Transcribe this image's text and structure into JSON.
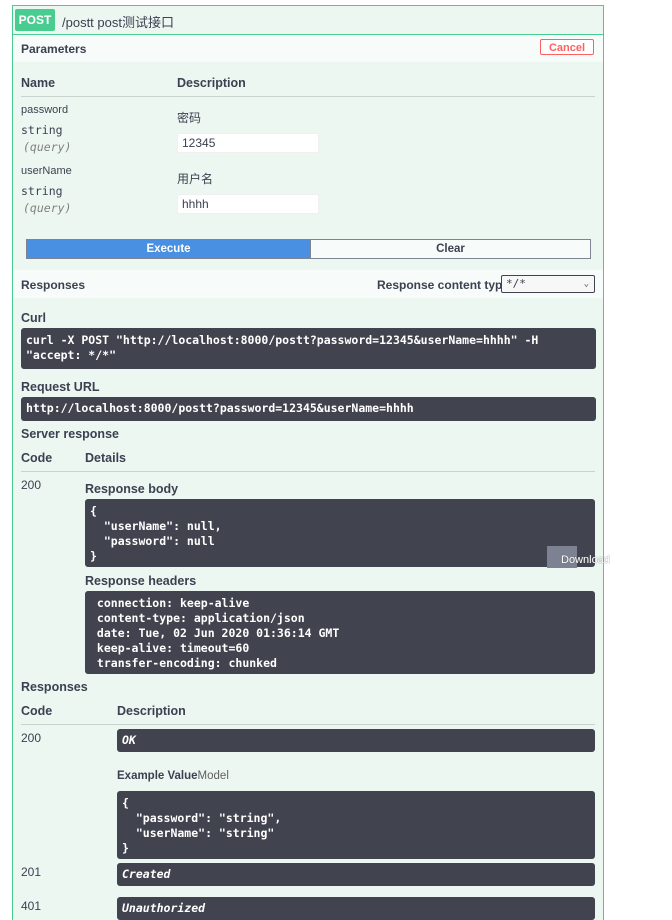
{
  "colors": {
    "post": "#49cc90",
    "execute": "#4990e2",
    "cancel": "#ff6060",
    "code_bg": "#41444e"
  },
  "summary": {
    "method": "POST",
    "path": "/postt",
    "description": "post测试接口"
  },
  "parameters": {
    "title": "Parameters",
    "cancel_label": "Cancel",
    "col_name": "Name",
    "col_description": "Description",
    "items": [
      {
        "name": "password",
        "type": "string",
        "in": "(query)",
        "description": "密码",
        "value": "12345"
      },
      {
        "name": "userName",
        "type": "string",
        "in": "(query)",
        "description": "用户名",
        "value": "hhhh"
      }
    ],
    "execute_label": "Execute",
    "clear_label": "Clear"
  },
  "responses_header": {
    "title": "Responses",
    "content_type_label": "Response content type",
    "content_type_value": "*/*"
  },
  "curl": {
    "label": "Curl",
    "command": "curl -X POST \"http://localhost:8000/postt?password=12345&userName=hhhh\" -H\n\"accept: */*\""
  },
  "request_url": {
    "label": "Request URL",
    "value": "http://localhost:8000/postt?password=12345&userName=hhhh"
  },
  "server_response": {
    "label": "Server response",
    "col_code": "Code",
    "col_details": "Details",
    "code": "200",
    "body_label": "Response body",
    "body": "{\n  \"userName\": null,\n  \"password\": null\n}",
    "download_label": "Download",
    "headers_label": "Response headers",
    "headers": " connection: keep-alive\n content-type: application/json\n date: Tue, 02 Jun 2020 01:36:14 GMT\n keep-alive: timeout=60\n transfer-encoding: chunked"
  },
  "responses": {
    "label": "Responses",
    "col_code": "Code",
    "col_description": "Description",
    "items": [
      {
        "code": "200",
        "description": "OK"
      },
      {
        "code": "201",
        "description": "Created"
      },
      {
        "code": "401",
        "description": "Unauthorized"
      }
    ],
    "example_value_label": "Example Value",
    "model_label": "Model",
    "example_value": "{\n  \"password\": \"string\",\n  \"userName\": \"string\"\n}"
  }
}
